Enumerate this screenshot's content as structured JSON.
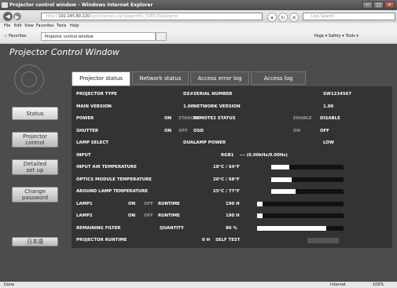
{
  "window": {
    "title": "Projector control window - Windows Internet Explorer"
  },
  "address": {
    "url_prefix": "http://",
    "url_host": "192.245.80.220",
    "url_path": "/cgi-bin/main.cgi?page=PJ1_STATUS&lang=e",
    "search_placeholder": "Live Search"
  },
  "menu": {
    "items": [
      "File",
      "Edit",
      "View",
      "Favorites",
      "Tools",
      "Help"
    ]
  },
  "favorites": {
    "label": "Favorites",
    "tab_label": "Projector control window",
    "right_tools": "Page ▾  Safety ▾  Tools ▾"
  },
  "page": {
    "title": "Projector Control Window"
  },
  "sidebar": {
    "items": [
      {
        "label": "Status"
      },
      {
        "label": "Projector\ncontrol"
      },
      {
        "label": "Detailed\nset up"
      },
      {
        "label": "Change\npassword"
      },
      {
        "label": "日本語"
      }
    ]
  },
  "tabs": [
    "Projector status",
    "Network status",
    "Access error log",
    "Access log"
  ],
  "status": {
    "rows": [
      {
        "l1": "PROJECTOR TYPE",
        "v1": "DZ#",
        "l2": "SERIAL NUMBER",
        "v2": "SW1234567"
      },
      {
        "l1": "MAIN VERSION",
        "v1": "1.00",
        "l2": "NETWORK VERSION",
        "v2": "1.00"
      },
      {
        "l1": "POWER",
        "v1a": "ON",
        "v1b": "STANDBY",
        "l2": "REMOTE2 STATUS",
        "v2a": "ENABLE",
        "v2b": "DISABLE"
      },
      {
        "l1": "SHUTTER",
        "v1a": "ON",
        "v1b": "OFF",
        "l2": "OSD",
        "v2a": "ON",
        "v2b": "OFF"
      },
      {
        "l1": "LAMP SELECT",
        "v1": "DUAL",
        "l2": "LAMP POWER",
        "v2": "LOW"
      },
      {
        "l1": "INPUT",
        "v1": "RGB1",
        "v2": "--- (0.00kHz/0.00Hz)"
      },
      {
        "l1": "INPUT AIR TEMPERATURE",
        "v1": "18°C / 64°F",
        "bar": 0.25
      },
      {
        "l1": "OPTICS MODULE TEMPERATURE",
        "v1": "20°C / 68°F",
        "bar": 0.28
      },
      {
        "l1": "AROUND LAMP TEMPERATURE",
        "v1": "25°C / 77°F",
        "bar": 0.34
      },
      {
        "l1": "LAMP1",
        "s1": "ON",
        "s2": "OFF",
        "l2": "RUNTIME",
        "v1": "190 H",
        "bar": 0.06
      },
      {
        "l1": "LAMP2",
        "s1": "ON",
        "s2": "OFF",
        "l2": "RUNTIME",
        "v1": "190 H",
        "bar": 0.06
      },
      {
        "l1": "REMAINING FILTER",
        "l2": "QUANTITY",
        "v1": "80 %",
        "bar": 0.8
      },
      {
        "l1": "PROJECTOR RUNTIME",
        "v1": "0 H",
        "l3": "SELF TEST"
      }
    ]
  },
  "statusbar": {
    "left": "Done",
    "zone": "Internet",
    "zoom": "100%"
  }
}
